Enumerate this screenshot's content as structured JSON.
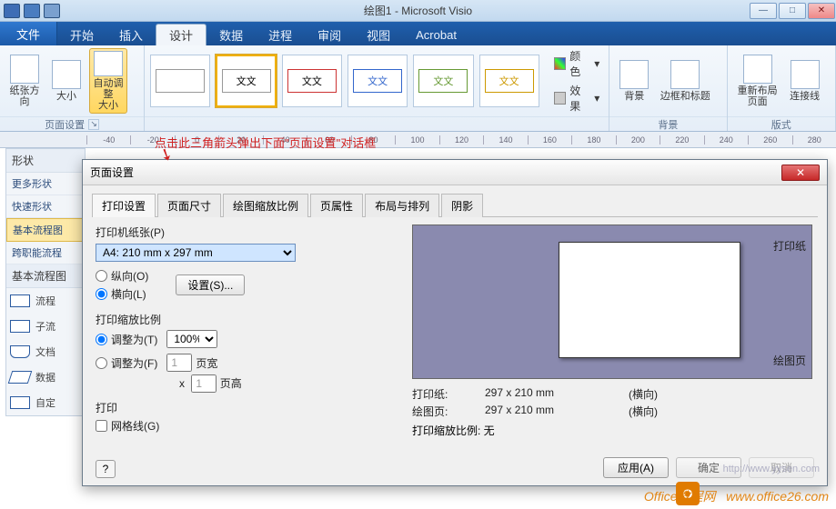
{
  "app": {
    "title": "绘图1 - Microsoft Visio"
  },
  "tabs": {
    "file": "文件",
    "items": [
      "开始",
      "插入",
      "设计",
      "数据",
      "进程",
      "审阅",
      "视图",
      "Acrobat"
    ],
    "activeIndex": 2
  },
  "ribbon": {
    "group_page_setup": {
      "label": "页面设置",
      "btn_orientation": "纸张方向",
      "btn_size": "大小",
      "btn_autofit": "自动调整\n大小"
    },
    "group_themes": {
      "sample_text": "文文",
      "color_label": "颜色",
      "effects_label": "效果"
    },
    "group_bg": {
      "label": "背景",
      "btn_bg": "背景",
      "btn_border": "边框和标题"
    },
    "group_layout": {
      "label": "版式",
      "btn_relayout": "重新布局\n页面",
      "btn_connectors": "连接线"
    }
  },
  "annotation": "点击此三角箭头弹出下面\"页面设置\"对话框",
  "shapes_pane": {
    "title": "形状",
    "more": "更多形状",
    "quick": "快速形状",
    "basic_flow": "基本流程图",
    "cross_func": "跨职能流程",
    "basic_flow2": "基本流程图",
    "items": [
      "流程",
      "子流",
      "文档",
      "数据",
      "自定"
    ]
  },
  "dialog": {
    "title": "页面设置",
    "tabs": [
      "打印设置",
      "页面尺寸",
      "绘图缩放比例",
      "页属性",
      "布局与排列",
      "阴影"
    ],
    "activeTab": 0,
    "section_paper": "打印机纸张(P)",
    "paper_value": "A4: 210 mm x 297 mm",
    "portrait": "纵向(O)",
    "landscape": "横向(L)",
    "btn_settings": "设置(S)...",
    "section_zoom": "打印缩放比例",
    "adjust_to": "调整为(T)",
    "adjust_pct": "100%",
    "adjust_pages": "调整为(F)",
    "pages_w": "1",
    "pages_w_lbl": "页宽",
    "pages_x": "x",
    "pages_h": "1",
    "pages_h_lbl": "页高",
    "section_print": "打印",
    "gridlines": "网格线(G)",
    "preview_paper_lbl": "打印纸",
    "preview_drawing_lbl": "绘图页",
    "info": {
      "paper": "打印纸:",
      "paper_v": "297 x 210 mm",
      "paper_o": "(横向)",
      "drawing": "绘图页:",
      "drawing_v": "297 x 210 mm",
      "drawing_o": "(横向)",
      "zoom": "打印缩放比例: 无"
    },
    "btn_apply": "应用(A)",
    "btn_ok": "确定",
    "btn_cancel": "取消"
  },
  "ruler_marks": [
    "-40",
    "-20",
    "0",
    "20",
    "40",
    "60",
    "80",
    "100",
    "120",
    "140",
    "160",
    "180",
    "200",
    "220",
    "240",
    "260",
    "280"
  ],
  "watermark": "www.office26.com",
  "watermark2": "http://www.yysen.com",
  "watermark3": "Office教程网"
}
